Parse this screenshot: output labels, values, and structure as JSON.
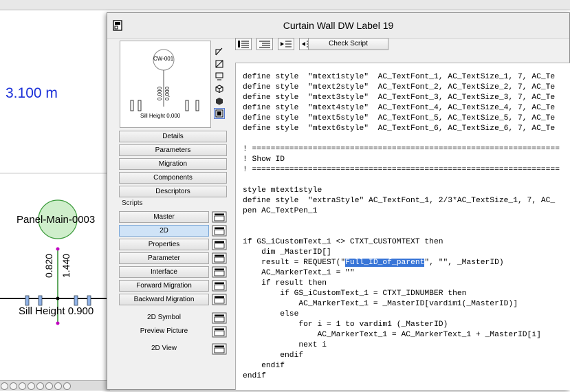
{
  "canvas": {
    "dimension": "3.100 m",
    "panel_label": "Panel-Main-0003",
    "dim_left": "0.820",
    "dim_right": "1.440",
    "sill_label": "Sill Height 0.900"
  },
  "dialog": {
    "title": "Curtain Wall DW Label 19",
    "preview": {
      "id": "CW-001",
      "value_a": "0,000",
      "value_b": "0,000",
      "sill": "Sill Height 0,000"
    },
    "sections": [
      "Details",
      "Parameters",
      "Migration",
      "Components",
      "Descriptors"
    ],
    "scripts_label": "Scripts",
    "scripts": [
      "Master",
      "2D",
      "Properties",
      "Parameter",
      "Interface",
      "Forward Migration",
      "Backward Migration"
    ],
    "active_script": "2D",
    "extras": [
      "2D Symbol",
      "Preview Picture"
    ],
    "view_label": "2D View",
    "check_script": "Check Script"
  },
  "code": {
    "lines": [
      "define style  \"mtext1style\"  AC_TextFont_1, AC_TextSize_1, 7, AC_Te",
      "define style  \"mtext2style\"  AC_TextFont_2, AC_TextSize_2, 7, AC_Te",
      "define style  \"mtext3style\"  AC_TextFont_3, AC_TextSize_3, 7, AC_Te",
      "define style  \"mtext4style\"  AC_TextFont_4, AC_TextSize_4, 7, AC_Te",
      "define style  \"mtext5style\"  AC_TextFont_5, AC_TextSize_5, 7, AC_Te",
      "define style  \"mtext6style\"  AC_TextFont_6, AC_TextSize_6, 7, AC_Te",
      "",
      "! ==================================================================",
      "! Show ID",
      "! ==================================================================",
      "",
      "style mtext1style",
      "define style  \"extraStyle\" AC_TextFont_1, 2/3*AC_TextSize_1, 7, AC_",
      "pen AC_TextPen_1",
      "",
      "",
      "if GS_iCustomText_1 <> CTXT_CUSTOMTEXT then",
      "    dim _MasterID[]",
      "    result = REQUEST(\"Full_ID_of_parent\", \"\", _MasterID)",
      "    AC_MarkerText_1 = \"\"",
      "    if result then",
      "        if GS_iCustomText_1 = CTXT_IDNUMBER then",
      "            AC_MarkerText_1 = _MasterID[vardim1(_MasterID)]",
      "        else",
      "            for i = 1 to vardim1 (_MasterID)",
      "                AC_MarkerText_1 = AC_MarkerText_1 + _MasterID[i]",
      "            next i",
      "        endif",
      "    endif",
      "endif"
    ],
    "highlight_text": "Full_ID_of_parent",
    "highlight_line": 18
  },
  "colors": {
    "dimension_blue": "#1a2fd8",
    "panel_fill": "#cfeecb",
    "panel_stroke": "#3a9a3a",
    "marker_magenta": "#c000c0",
    "selection_blue": "#3875d7"
  }
}
